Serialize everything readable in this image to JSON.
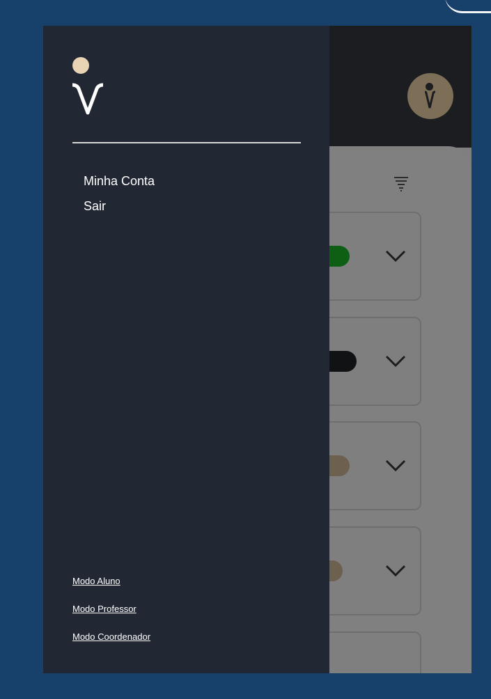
{
  "drawer": {
    "menu": [
      {
        "label": "Minha Conta"
      },
      {
        "label": "Sair"
      }
    ],
    "modes": [
      {
        "label": "Modo Aluno"
      },
      {
        "label": "Modo Professor"
      },
      {
        "label": "Modo Coordenador"
      }
    ],
    "logo_icon": "institution-logo-icon"
  },
  "colors": {
    "frame": "#17406a",
    "drawer_bg": "#222833",
    "header_bg": "#1b1d20",
    "logo_dot": "#e8d3b4",
    "overlay": "#7f7f7f"
  },
  "background_list": {
    "badge_colors": [
      "green",
      "black",
      "brown",
      "brown"
    ],
    "icons": [
      "filter-icon",
      "chevron-down-icon",
      "avatar-icon"
    ]
  }
}
